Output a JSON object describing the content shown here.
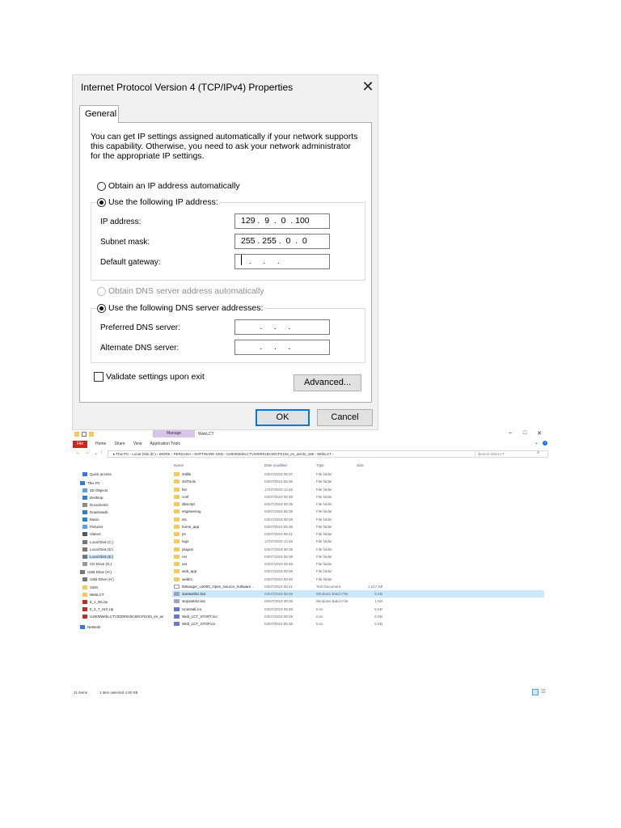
{
  "dialog": {
    "title": "Internet Protocol Version 4 (TCP/IPv4) Properties",
    "close_glyph": "✕",
    "tab_label": "General",
    "intro_text": "You can get IP settings assigned automatically if your network supports\nthis capability. Otherwise, you need to ask your network administrator\nfor the appropriate IP settings.",
    "ip_auto_label": "Obtain an IP address automatically",
    "ip_manual_label": "Use the following IP address:",
    "ip_address_label": "IP address:",
    "ip_address_value": "129 .  9  .  0  . 100",
    "subnet_label": "Subnet mask:",
    "subnet_value": "255 . 255 .  0  .  0",
    "gateway_label": "Default gateway:",
    "gateway_value": "   .     .     .",
    "dns_auto_label": "Obtain DNS server address automatically",
    "dns_manual_label": "Use the following DNS server addresses:",
    "preferred_dns_label": "Preferred DNS server:",
    "preferred_dns_value": "        .     .     .",
    "alternate_dns_label": "Alternate DNS server:",
    "alternate_dns_value": "        .     .     .",
    "validate_label": "Validate settings upon exit",
    "advanced_label": "Advanced...",
    "ok_label": "OK",
    "cancel_label": "Cancel"
  },
  "explorer": {
    "manage_tab": "Manage",
    "window_title": "WebLCT",
    "minimize_glyph": "–",
    "maximize_glyph": "□",
    "close_glyph": "✕",
    "collapse_glyph": "⌄",
    "help_glyph": "?",
    "ribbon": {
      "file": "File",
      "tabs": [
        "Home",
        "Share",
        "View",
        "Application Tools"
      ]
    },
    "nav_glyphs": {
      "back": "←",
      "forward": "→",
      "down": "⌄",
      "up": "↑",
      "chevron": "⌄",
      "refresh": "↻"
    },
    "address_path": "▸ This PC  ›  Local Disk (E:)  ›  WORK  ›  PERSADA  ›  SOFTWARE NSN  ›  U2000WebLCTV200R019C60CP2103_en_win32_x86  ›  WebLCT  ›",
    "search_placeholder": "Search WebLCT",
    "search_glyph": "⌕",
    "nav_pane": [
      {
        "label": "Quick access",
        "color": "#3b78d8"
      },
      {
        "label": "This PC",
        "color": "#3b78d8"
      },
      {
        "label": "3D Objects",
        "color": "#5aa0e6"
      },
      {
        "label": "Desktop",
        "color": "#2f7fd0"
      },
      {
        "label": "Documents",
        "color": "#8a8a8a"
      },
      {
        "label": "Downloads",
        "color": "#2f7fd0"
      },
      {
        "label": "Music",
        "color": "#2f7fd0"
      },
      {
        "label": "Pictures",
        "color": "#5aa0e6"
      },
      {
        "label": "Videos",
        "color": "#555555"
      },
      {
        "label": "Local Disk (C:)",
        "color": "#777777"
      },
      {
        "label": "Local Disk (D:)",
        "color": "#777777"
      },
      {
        "label": "Local Disk (E:)",
        "color": "#777777"
      },
      {
        "label": "CD Drive (G:)",
        "color": "#999999"
      },
      {
        "label": "USB Drive (H:)",
        "color": "#777777"
      },
      {
        "label": "USB Drive (H:)",
        "color": "#777777"
      },
      {
        "label": "1820",
        "color": "#f4c95d"
      },
      {
        "label": "WebLCT",
        "color": "#f4c95d"
      },
      {
        "label": "8_1_90.zip",
        "color": "#b5322b"
      },
      {
        "label": "8_2_7_Hr2.zip",
        "color": "#b5322b"
      },
      {
        "label": "U2000WebLCTV200R019C60CP2103_en_wi",
        "color": "#b5322b"
      },
      {
        "label": "Network",
        "color": "#3b78d8"
      }
    ],
    "columns": {
      "name": "Name",
      "date": "Date modified",
      "type": "Type",
      "size": "Size"
    },
    "files": [
      {
        "name": "3rdlib",
        "date": "04/07/2019 08:37",
        "type": "File folder",
        "size": "",
        "icon": "folder"
      },
      {
        "name": "3rdTools",
        "date": "04/07/2019 08:36",
        "type": "File folder",
        "size": "",
        "icon": "folder"
      },
      {
        "name": "bin",
        "date": "17/07/2020 14:45",
        "type": "File folder",
        "size": "",
        "icon": "folder"
      },
      {
        "name": "conf",
        "date": "04/07/2019 08:38",
        "type": "File folder",
        "size": "",
        "icon": "folder"
      },
      {
        "name": "dbscript",
        "date": "04/07/2019 08:38",
        "type": "File folder",
        "size": "",
        "icon": "folder"
      },
      {
        "name": "engineering",
        "date": "04/07/2019 08:38",
        "type": "File folder",
        "size": "",
        "icon": "folder"
      },
      {
        "name": "etc",
        "date": "04/07/2019 08:38",
        "type": "File folder",
        "size": "",
        "icon": "folder"
      },
      {
        "name": "home_app",
        "date": "04/07/2019 08:38",
        "type": "File folder",
        "size": "",
        "icon": "folder"
      },
      {
        "name": "jre",
        "date": "04/07/2019 08:41",
        "type": "File folder",
        "size": "",
        "icon": "folder"
      },
      {
        "name": "logs",
        "date": "17/07/2020 14:45",
        "type": "File folder",
        "size": "",
        "icon": "folder"
      },
      {
        "name": "plugins",
        "date": "04/07/2019 08:38",
        "type": "File folder",
        "size": "",
        "icon": "folder"
      },
      {
        "name": "res",
        "date": "04/07/2019 08:38",
        "type": "File folder",
        "size": "",
        "icon": "folder"
      },
      {
        "name": "var",
        "date": "04/07/2019 08:38",
        "type": "File folder",
        "size": "",
        "icon": "folder"
      },
      {
        "name": "web_app",
        "date": "04/07/2019 08:38",
        "type": "File folder",
        "size": "",
        "icon": "folder"
      },
      {
        "name": "weblct",
        "date": "04/07/2019 08:40",
        "type": "File folder",
        "size": "",
        "icon": "folder"
      },
      {
        "name": "IManager_U2000_Open_Source_Software...",
        "date": "04/07/2019 08:41",
        "type": "Text Document",
        "size": "1,217 KB",
        "icon": "text"
      },
      {
        "name": "startweblct.bat",
        "date": "04/07/2019 08:38",
        "type": "Windows Batch File",
        "size": "5 KB",
        "icon": "bat",
        "selected": true
      },
      {
        "name": "stopweblct.bat",
        "date": "04/07/2019 08:38",
        "type": "Windows Batch File",
        "size": "1 KB",
        "icon": "bat"
      },
      {
        "name": "Uninstall.ico",
        "date": "04/07/2019 08:38",
        "type": "Icon",
        "size": "5 KB",
        "icon": "img"
      },
      {
        "name": "Web_LCT_START.ico",
        "date": "04/07/2019 08:38",
        "type": "Icon",
        "size": "6 KB",
        "icon": "img"
      },
      {
        "name": "Web_LCT_STOP.ico",
        "date": "04/07/2019 08:38",
        "type": "Icon",
        "size": "6 KB",
        "icon": "img"
      }
    ],
    "status_items": "21 items",
    "status_selected": "1 item selected  4.50 KB",
    "view_tiles_glyph": "☷"
  }
}
